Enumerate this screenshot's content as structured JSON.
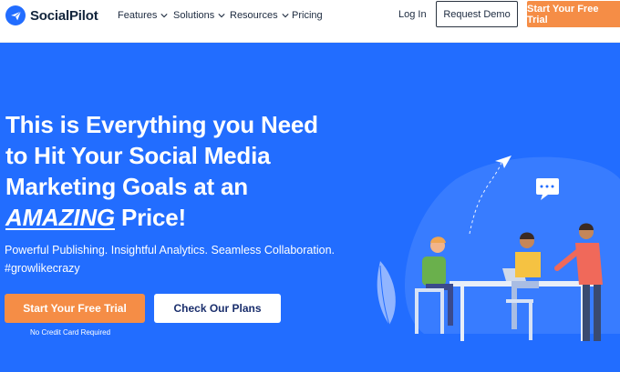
{
  "brand": {
    "name": "SocialPilot"
  },
  "nav": {
    "items": [
      {
        "label": "Features",
        "has_dropdown": true
      },
      {
        "label": "Solutions",
        "has_dropdown": true
      },
      {
        "label": "Resources",
        "has_dropdown": true
      },
      {
        "label": "Pricing",
        "has_dropdown": false
      }
    ],
    "login": "Log In",
    "request_demo": "Request Demo",
    "free_trial": "Start Your Free Trial"
  },
  "hero": {
    "headline_line1": "This is Everything you Need",
    "headline_line2": "to Hit Your Social Media",
    "headline_line3": "Marketing Goals at an",
    "headline_emphasis": "AMAZING",
    "headline_tail": " Price!",
    "subheading": "Powerful Publishing. Insightful Analytics. Seamless Collaboration.",
    "hashtag": "#growlikecrazy",
    "primary_cta": "Start Your Free Trial",
    "secondary_cta": "Check Our Plans",
    "note": "No Credit Card Required"
  },
  "colors": {
    "brand_blue": "#226dff",
    "accent_orange": "#f58d46",
    "nav_text": "#1c2a3f",
    "white": "#ffffff"
  },
  "icons": {
    "logo": "paper-plane-icon",
    "dropdown": "chevron-down-icon"
  }
}
